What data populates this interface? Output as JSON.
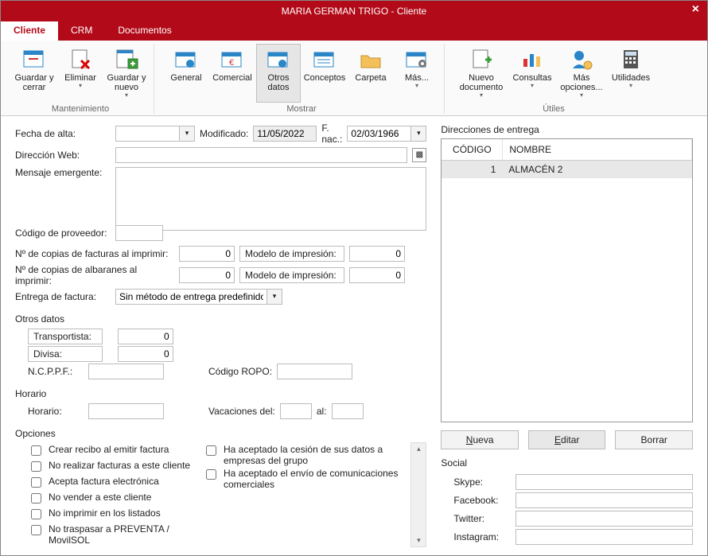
{
  "window": {
    "title": "MARIA GERMAN TRIGO - Cliente"
  },
  "tabs": {
    "cliente": "Cliente",
    "crm": "CRM",
    "documentos": "Documentos"
  },
  "ribbon": {
    "groups": {
      "mantenimiento": {
        "caption": "Mantenimiento",
        "guardar_cerrar": "Guardar y cerrar",
        "eliminar": "Eliminar",
        "guardar_nuevo": "Guardar y nuevo"
      },
      "mostrar": {
        "caption": "Mostrar",
        "general": "General",
        "comercial": "Comercial",
        "otros_datos": "Otros datos",
        "conceptos": "Conceptos",
        "carpeta": "Carpeta",
        "mas": "Más..."
      },
      "utiles": {
        "caption": "Útiles",
        "nuevo_doc": "Nuevo documento",
        "consultas": "Consultas",
        "mas_opciones": "Más opciones...",
        "utilidades": "Utilidades"
      }
    }
  },
  "form": {
    "labels": {
      "fecha_alta": "Fecha de alta:",
      "modificado": "Modificado:",
      "fnac": "F. nac.:",
      "direccion_web": "Dirección Web:",
      "mensaje": "Mensaje emergente:",
      "codigo_proveedor": "Código de proveedor:",
      "copias_fact": "Nº de copias de facturas al imprimir:",
      "copias_alb": "Nº de copias de albaranes al imprimir:",
      "modelo_imp": "Modelo de impresión:",
      "entrega_fact": "Entrega de factura:",
      "otros_datos": "Otros datos",
      "transportista": "Transportista:",
      "divisa": "Divisa:",
      "ncppf": "N.C.P.P.F.:",
      "codigo_ropo": "Código ROPO:",
      "horario_sec": "Horario",
      "horario": "Horario:",
      "vacaciones_del": "Vacaciones del:",
      "al": "al:",
      "opciones": "Opciones"
    },
    "values": {
      "fecha_alta": "",
      "modificado": "11/05/2022",
      "fnac": "02/03/1966",
      "direccion_web": "",
      "mensaje": "",
      "codigo_proveedor": "",
      "copias_fact": "0",
      "copias_alb": "0",
      "modelo_imp_fact": "0",
      "modelo_imp_alb": "0",
      "entrega_fact": "Sin método de entrega predefinido",
      "transportista": "0",
      "divisa": "0",
      "ncppf": "",
      "codigo_ropo": "",
      "horario": "",
      "vac_del": "",
      "vac_al": ""
    },
    "options": {
      "crear_recibo": "Crear recibo al emitir factura",
      "no_facturas": "No realizar facturas a este cliente",
      "acepta_fe": "Acepta factura electrónica",
      "no_vender": "No vender a este cliente",
      "no_imprimir": "No imprimir en los listados",
      "no_traspasar": "No traspasar a PREVENTA / MovilSOL",
      "cesion_datos": "Ha aceptado la cesión de sus datos a empresas del grupo",
      "com_comerc": "Ha aceptado el envío de comunicaciones comerciales"
    }
  },
  "delivery": {
    "title": "Direcciones de entrega",
    "cols": {
      "codigo": "CÓDIGO",
      "nombre": "NOMBRE"
    },
    "rows": [
      {
        "codigo": "1",
        "nombre": "ALMACÉN 2"
      }
    ],
    "btn_nueva": "Nueva",
    "btn_editar": "Editar",
    "btn_borrar": "Borrar",
    "mn_n": "N",
    "mn_e": "E"
  },
  "social": {
    "title": "Social",
    "skype": "Skype:",
    "facebook": "Facebook:",
    "twitter": "Twitter:",
    "instagram": "Instagram:",
    "v_skype": "",
    "v_facebook": "",
    "v_twitter": "",
    "v_instagram": ""
  }
}
